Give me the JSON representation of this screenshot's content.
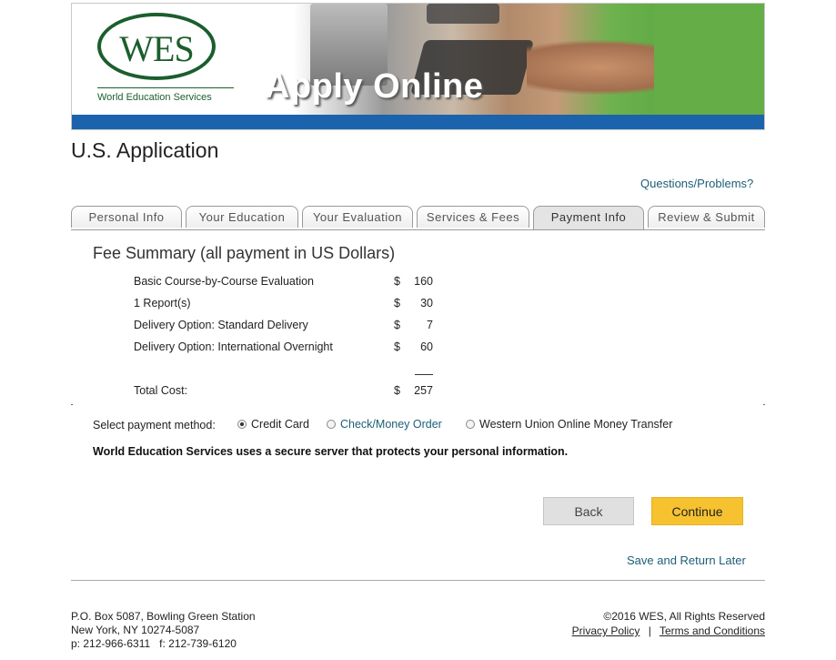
{
  "header": {
    "logo_text": "WES",
    "logo_subtitle": "World Education Services",
    "banner_title": "Apply Online"
  },
  "page_title": "U.S. Application",
  "help_link": "Questions/Problems?",
  "tabs": [
    {
      "label": "Personal Info",
      "active": false
    },
    {
      "label": "Your Education",
      "active": false
    },
    {
      "label": "Your Evaluation",
      "active": false
    },
    {
      "label": "Services & Fees",
      "active": false
    },
    {
      "label": "Payment Info",
      "active": true
    },
    {
      "label": "Review & Submit",
      "active": false
    }
  ],
  "fee_summary": {
    "title": "Fee Summary (all payment in US Dollars)",
    "currency": "$",
    "items": [
      {
        "label": "Basic Course-by-Course Evaluation",
        "amount": "160"
      },
      {
        "label": "1 Report(s)",
        "amount": "30"
      },
      {
        "label": "Delivery Option: Standard Delivery",
        "amount": "7"
      },
      {
        "label": "Delivery Option: International Overnight",
        "amount": "60"
      }
    ],
    "total_label": "Total Cost:",
    "total_amount": "257"
  },
  "payment": {
    "label": "Select payment method:",
    "options": [
      {
        "label": "Credit Card",
        "selected": true
      },
      {
        "label": "Check/Money Order",
        "selected": false
      },
      {
        "label": "Western Union Online Money Transfer",
        "selected": false
      }
    ],
    "secure_notice": "World Education Services uses a secure server that protects your personal information."
  },
  "buttons": {
    "back": "Back",
    "continue": "Continue",
    "save_later": "Save and Return Later"
  },
  "footer": {
    "address_line1": "P.O. Box 5087, Bowling Green Station",
    "address_line2": "New York, NY 10274-5087",
    "phone_line": "p: 212-966-6311   f: 212-739-6120",
    "copyright": "©2016 WES, All Rights Reserved",
    "privacy": "Privacy Policy",
    "separator": "|",
    "terms": "Terms and Conditions"
  },
  "colors": {
    "brand_green": "#1b5e2e",
    "banner_blue": "#1b63ac",
    "continue_yellow": "#f6c230",
    "link_teal": "#1c5e78"
  }
}
